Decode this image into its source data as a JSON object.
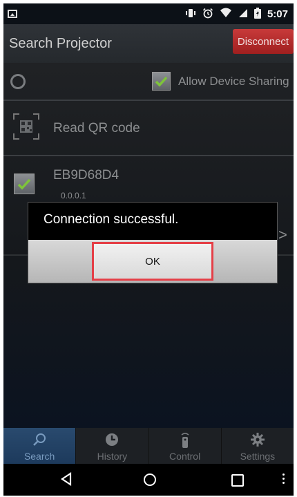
{
  "status_bar": {
    "time": "5:07",
    "icons": [
      "image-icon",
      "vibrate-icon",
      "alarm-icon",
      "wifi-icon",
      "signal-icon",
      "battery-icon"
    ]
  },
  "action_bar": {
    "title": "Search Projector",
    "disconnect_label": "Disconnect"
  },
  "sharing": {
    "label": "Allow Device Sharing",
    "checked": true
  },
  "qr": {
    "label": "Read QR code"
  },
  "device": {
    "name": "EB9D68D4",
    "ip": "0.0.0.1",
    "checked": true
  },
  "dialog": {
    "message": "Connection successful.",
    "ok_label": "OK"
  },
  "tabs": [
    {
      "label": "Search",
      "icon": "search-icon",
      "active": true
    },
    {
      "label": "History",
      "icon": "clock-icon",
      "active": false
    },
    {
      "label": "Control",
      "icon": "remote-icon",
      "active": false
    },
    {
      "label": "Settings",
      "icon": "gear-icon",
      "active": false
    }
  ],
  "colors": {
    "accent_red": "#b02a2a",
    "check_green": "#7ec43a",
    "highlight_box": "#e53f47",
    "active_tab": "#294a6e"
  }
}
